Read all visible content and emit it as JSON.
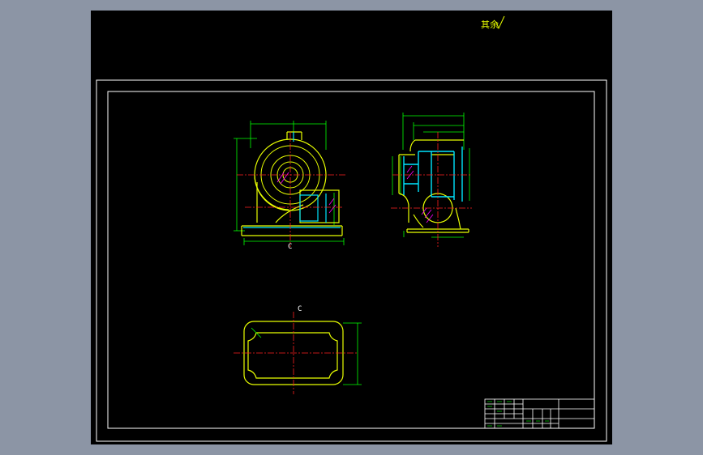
{
  "drawing": {
    "roughness_note": "其余",
    "section_labels": [
      "C",
      "C"
    ],
    "colors": {
      "background": "#000000",
      "frame": "#ffffff",
      "outline": "#e8ff00",
      "dimension": "#00ff00",
      "hidden": "#00e5ff",
      "centerline": "#ff2020",
      "hatch": "#ff00ff",
      "window_bg": "#8c95a5"
    }
  }
}
